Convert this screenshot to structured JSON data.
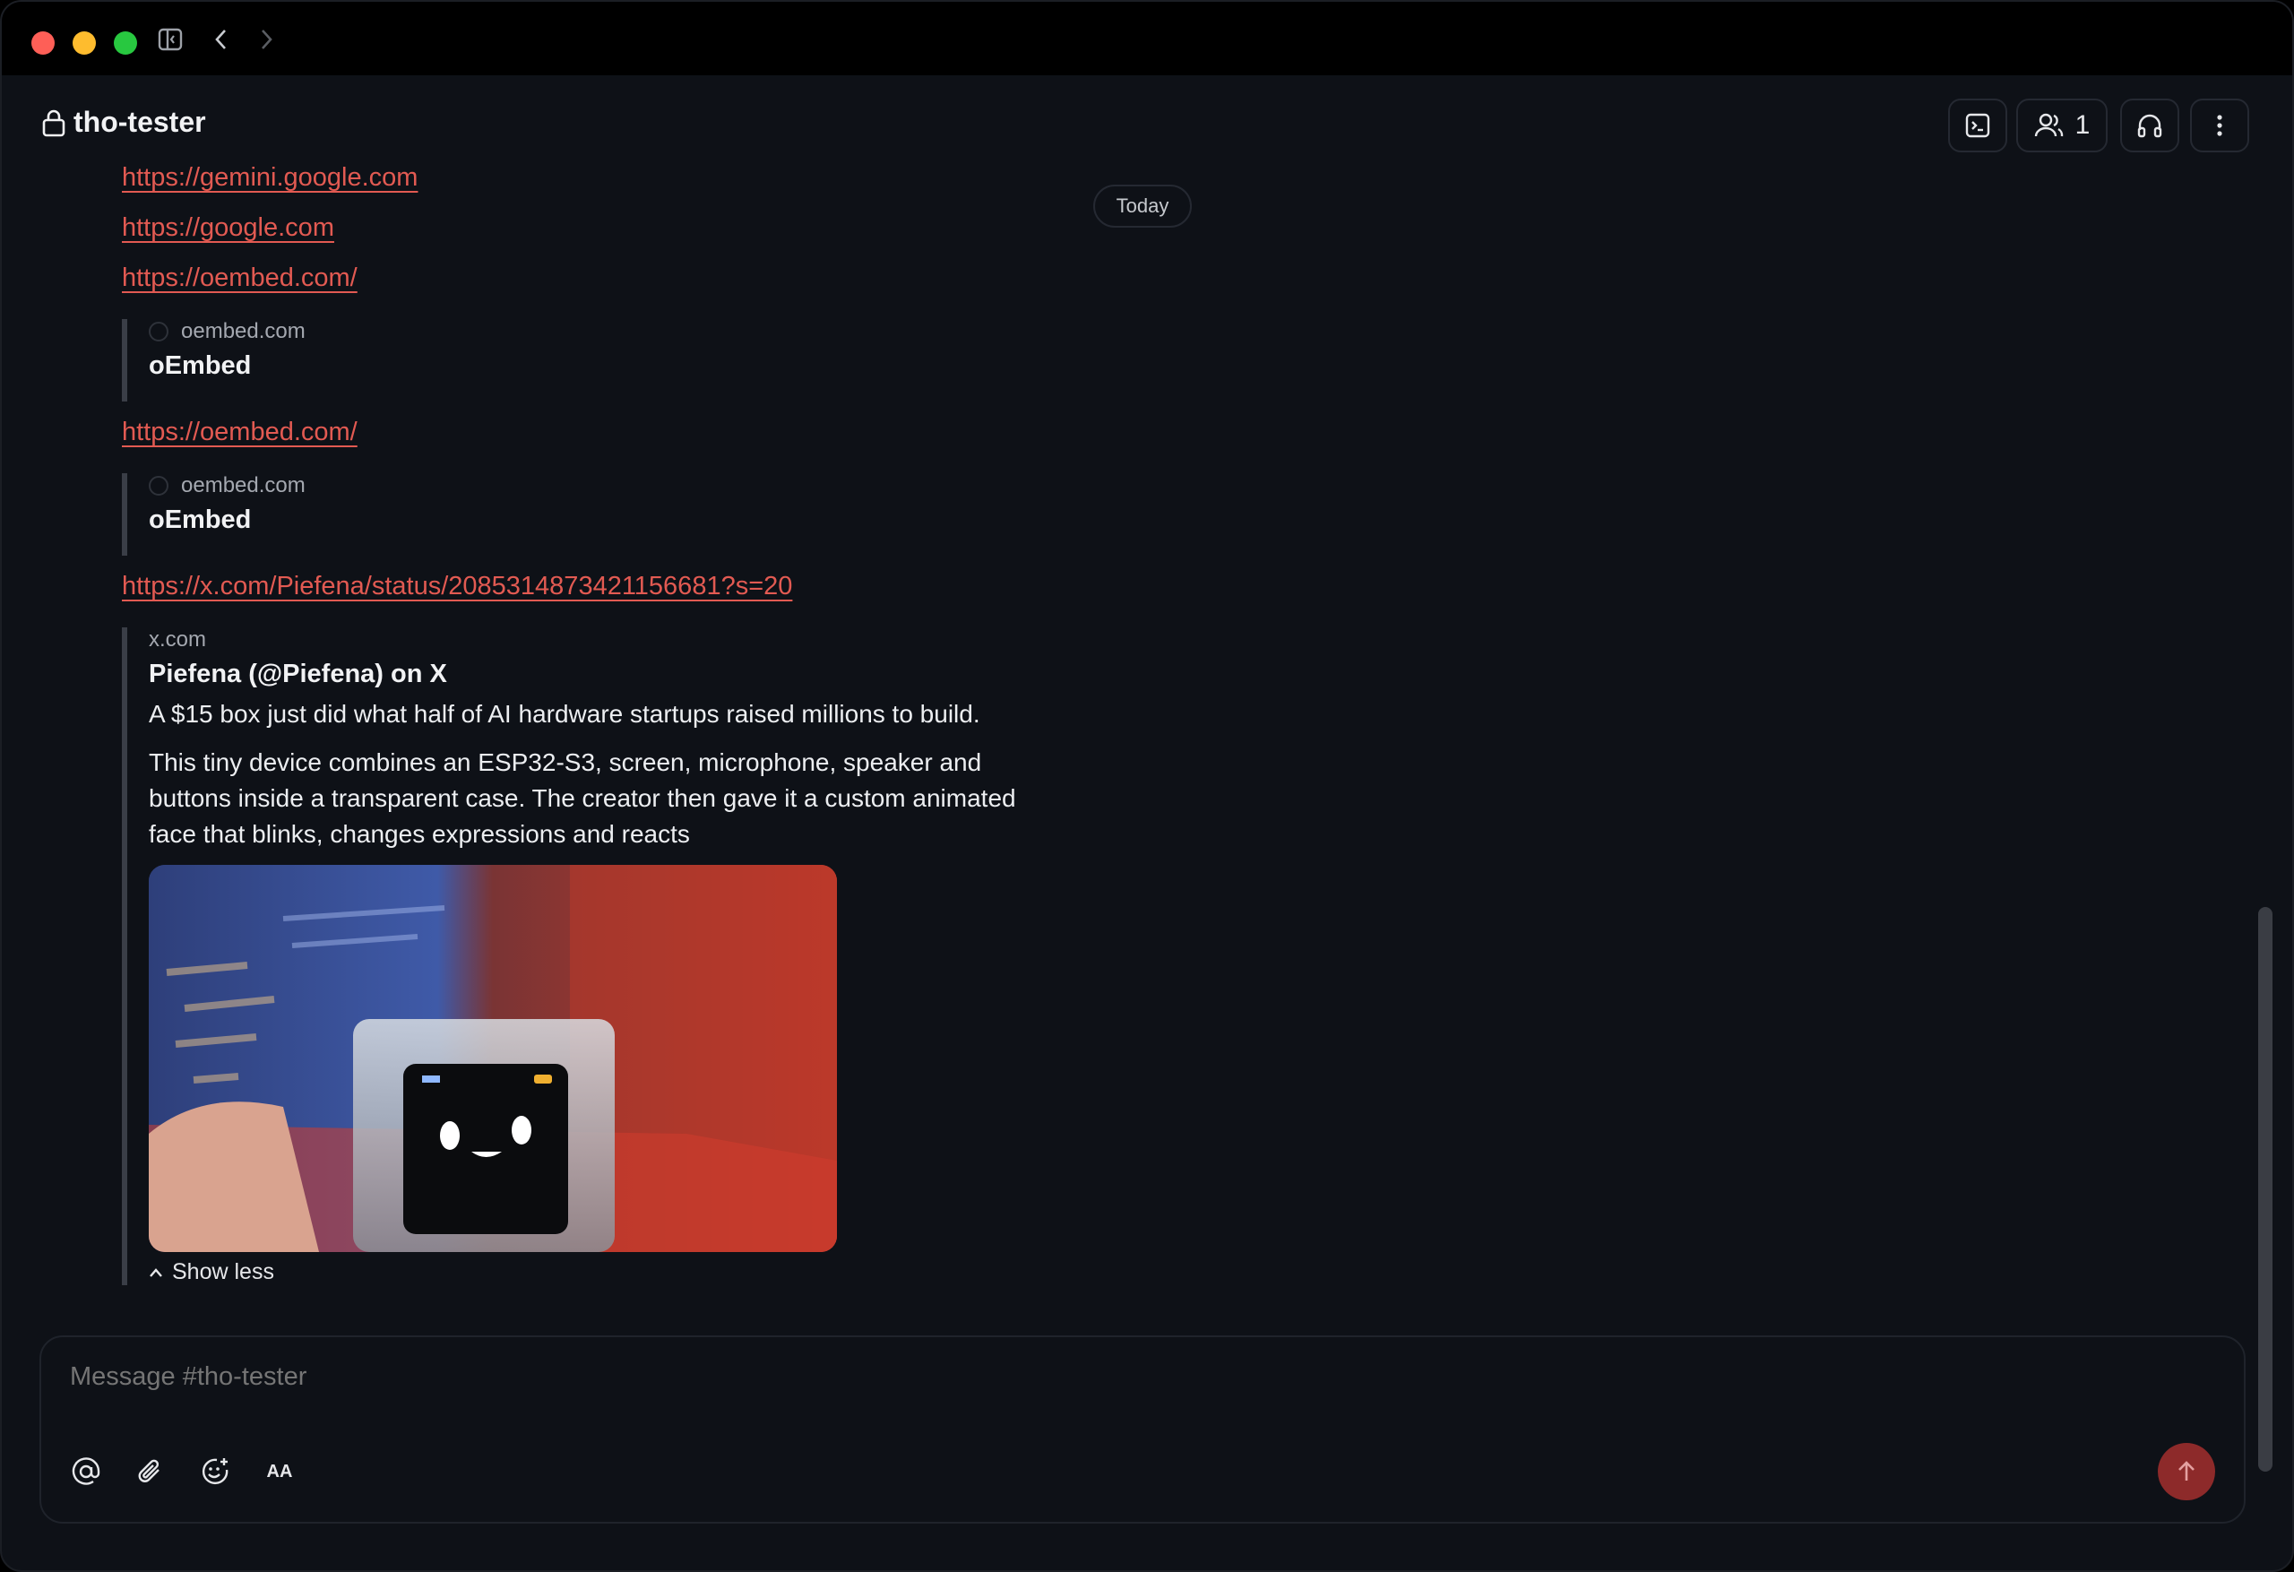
{
  "window": {
    "nav": {
      "back_icon": "chevron-left-icon",
      "forward_icon": "chevron-right-icon",
      "sidebar_icon": "sidebar-toggle-icon"
    }
  },
  "header": {
    "channel_name": "tho-tester",
    "channel_icon": "lock-icon",
    "members_count": "1",
    "buttons": [
      "terminal-icon",
      "members-icon",
      "headphones-icon",
      "more-vertical-icon"
    ]
  },
  "date_divider": "Today",
  "messages": {
    "links": {
      "gemini": "https://gemini.google.com",
      "google": "https://google.com",
      "oembed_1": "https://oembed.com/",
      "oembed_2": "https://oembed.com/",
      "x_status": "https://x.com/Piefena/status/2085314873421156681?s=20"
    },
    "embed_oembed_1": {
      "site": "oembed.com",
      "title": "oEmbed"
    },
    "embed_oembed_2": {
      "site": "oembed.com",
      "title": "oEmbed"
    },
    "embed_x": {
      "site": "x.com",
      "title": "Piefena (@Piefena) on X",
      "line1": "A $15 box just did what half of AI hardware startups raised millions to build.",
      "line2": "This tiny device combines an ESP32-S3, screen, microphone, speaker and buttons inside a transparent case. The creator then gave it a custom animated face that blinks, changes expressions and reacts",
      "show_less": "Show less"
    }
  },
  "composer": {
    "placeholder": "Message #tho-tester",
    "tools": [
      "mention-icon",
      "attachment-icon",
      "emoji-add-icon",
      "text-format-icon"
    ],
    "format_label": "AA",
    "send_icon": "arrow-up-icon"
  },
  "colors": {
    "link": "#e25a52",
    "send_button": "#8d2a2a",
    "background": "#0e1117"
  }
}
